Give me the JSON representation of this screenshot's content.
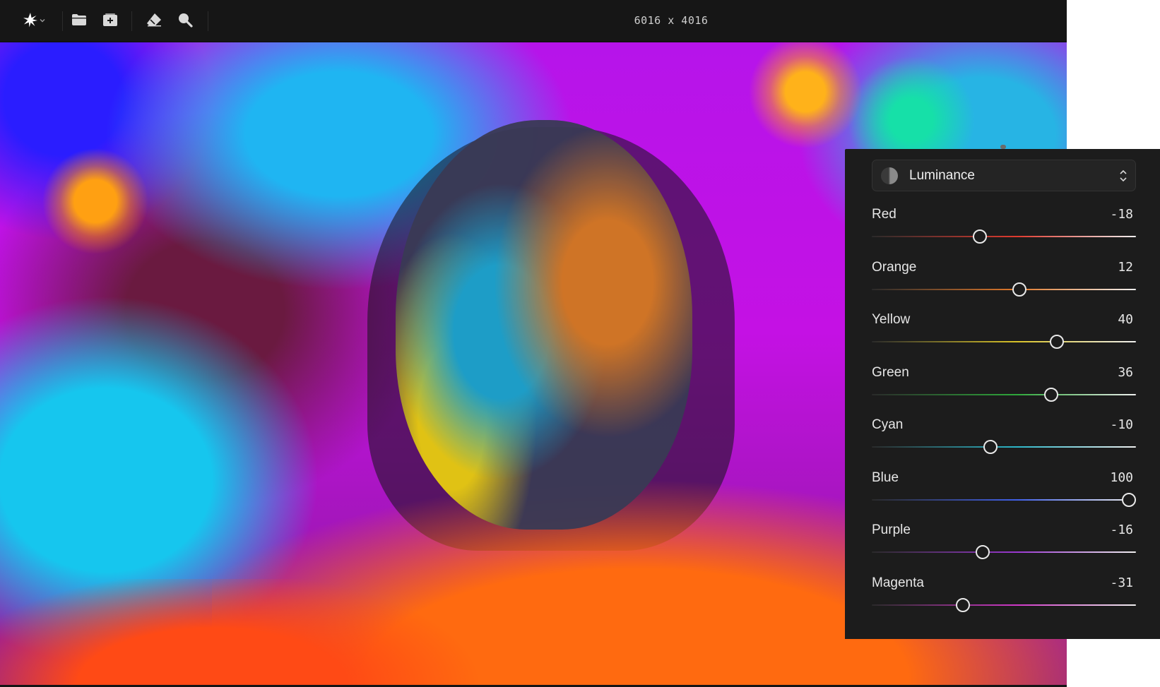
{
  "toolbar": {
    "buttons": [
      {
        "name": "ai-sparkle-icon",
        "label": ""
      },
      {
        "name": "folder-icon",
        "label": ""
      },
      {
        "name": "add-image-icon",
        "label": ""
      },
      {
        "name": "eraser-icon",
        "label": ""
      },
      {
        "name": "zoom-icon",
        "label": ""
      }
    ],
    "image_dimensions": "6016 x 4016"
  },
  "panel": {
    "mode": {
      "icon": "luminance-icon",
      "label": "Luminance"
    },
    "sliders": [
      {
        "label": "Red",
        "value": "-18",
        "level": -18,
        "color": "#e03a2e"
      },
      {
        "label": "Orange",
        "value": "12",
        "level": 12,
        "color": "#e0782a"
      },
      {
        "label": "Yellow",
        "value": "40",
        "level": 40,
        "color": "#d8c228"
      },
      {
        "label": "Green",
        "value": "36",
        "level": 36,
        "color": "#2ea83a"
      },
      {
        "label": "Cyan",
        "value": "-10",
        "level": -10,
        "color": "#2cb6c8"
      },
      {
        "label": "Blue",
        "value": "100",
        "level": 100,
        "color": "#4060e8"
      },
      {
        "label": "Purple",
        "value": "-16",
        "level": -16,
        "color": "#9a38d0"
      },
      {
        "label": "Magenta",
        "value": "-31",
        "level": -31,
        "color": "#d038c8"
      }
    ]
  }
}
